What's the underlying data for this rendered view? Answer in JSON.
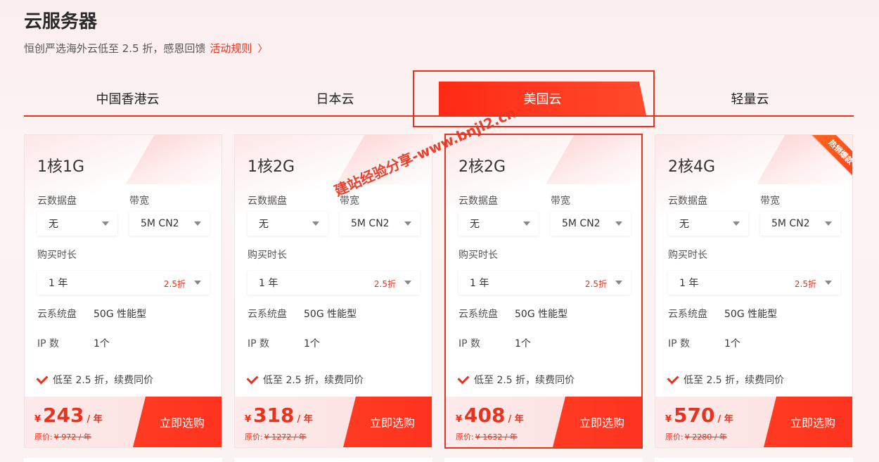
{
  "page": {
    "title": "云服务器",
    "subtitle": "恒创严选海外云低至 2.5 折，感恩回馈",
    "rules_link": "活动规则",
    "rules_chevron": "〉"
  },
  "tabs": [
    {
      "label": "中国香港云",
      "active": false
    },
    {
      "label": "日本云",
      "active": false
    },
    {
      "label": "美国云",
      "active": true
    },
    {
      "label": "轻量云",
      "active": false
    }
  ],
  "labels": {
    "disk": "云数据盘",
    "bandwidth": "带宽",
    "duration": "购买时长",
    "system_disk": "云系统盘",
    "ip_count": "IP 数",
    "promo": "低至 2.5 折，续费同价",
    "buy": "立即选购",
    "currency": "¥",
    "per_year": "/ 年",
    "orig_prefix": "原价:"
  },
  "cards": [
    {
      "spec": "1核1G",
      "disk": "无",
      "bandwidth": "5M CN2",
      "duration": "1 年",
      "discount": "2.5折",
      "system_disk": "50G 性能型",
      "ip": "1个",
      "price": "243",
      "orig_price": "¥ 972 / 年",
      "hot": false
    },
    {
      "spec": "1核2G",
      "disk": "无",
      "bandwidth": "5M CN2",
      "duration": "1 年",
      "discount": "2.5折",
      "system_disk": "50G 性能型",
      "ip": "1个",
      "price": "318",
      "orig_price": "¥ 1272 / 年",
      "hot": false
    },
    {
      "spec": "2核2G",
      "disk": "无",
      "bandwidth": "5M CN2",
      "duration": "1 年",
      "discount": "2.5折",
      "system_disk": "50G 性能型",
      "ip": "1个",
      "price": "408",
      "orig_price": "¥ 1632 / 年",
      "hot": false
    },
    {
      "spec": "2核4G",
      "disk": "无",
      "bandwidth": "5M CN2",
      "duration": "1 年",
      "discount": "2.5折",
      "system_disk": "50G 性能型",
      "ip": "1个",
      "price": "570",
      "orig_price": "¥ 2280 / 年",
      "hot": true
    }
  ],
  "hot_badge": "热销爆款",
  "watermark": "建站经验分享-www.bnjl2.cn",
  "colors": {
    "accent": "#e8331f",
    "background": "#fbeeee"
  }
}
